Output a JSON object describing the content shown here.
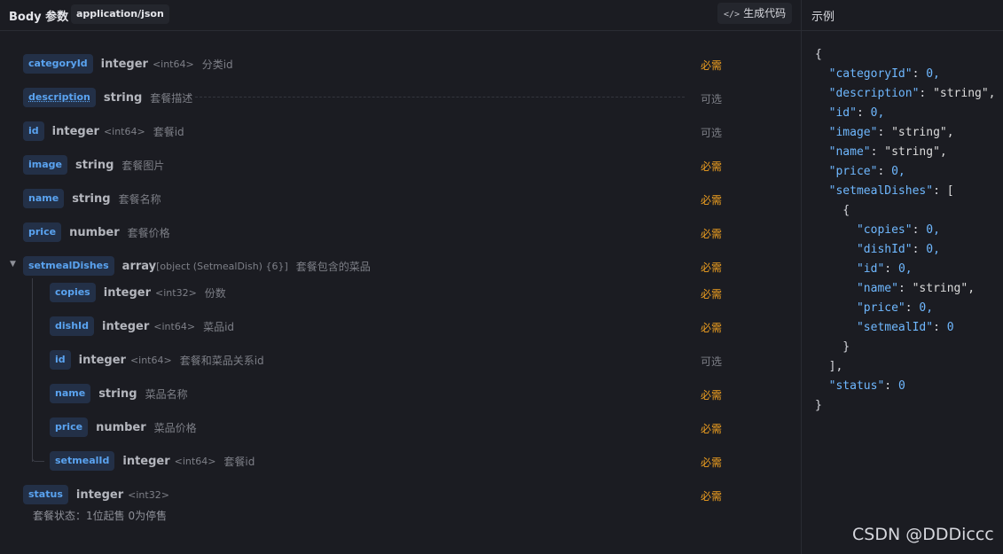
{
  "header": {
    "title": "Body 参数",
    "content_type": "application/json",
    "generate_button": "生成代码",
    "code_glyph": "</>"
  },
  "example": {
    "title": "示例"
  },
  "fields": [
    {
      "name": "categoryId",
      "type": "integer",
      "format": "<int64>",
      "description": "分类id",
      "required": "必需"
    },
    {
      "name": "description",
      "type": "string",
      "format": "",
      "description": "套餐描述",
      "required": "可选"
    },
    {
      "name": "id",
      "type": "integer",
      "format": "<int64>",
      "description": "套餐id",
      "required": "可选"
    },
    {
      "name": "image",
      "type": "string",
      "format": "",
      "description": "套餐图片",
      "required": "必需"
    },
    {
      "name": "name",
      "type": "string",
      "format": "",
      "description": "套餐名称",
      "required": "必需"
    },
    {
      "name": "price",
      "type": "number",
      "format": "",
      "description": "套餐价格",
      "required": "必需"
    },
    {
      "name": "setmealDishes",
      "type": "array",
      "format": "[object (SetmealDish) {6}]",
      "description": "套餐包含的菜品",
      "required": "必需",
      "caret": "▼"
    },
    {
      "name": "copies",
      "type": "integer",
      "format": "<int32>",
      "description": "份数",
      "required": "必需"
    },
    {
      "name": "dishId",
      "type": "integer",
      "format": "<int64>",
      "description": "菜品id",
      "required": "必需"
    },
    {
      "name": "id",
      "type": "integer",
      "format": "<int64>",
      "description": "套餐和菜品关系id",
      "required": "可选"
    },
    {
      "name": "name",
      "type": "string",
      "format": "",
      "description": "菜品名称",
      "required": "必需"
    },
    {
      "name": "price",
      "type": "number",
      "format": "",
      "description": "菜品价格",
      "required": "必需"
    },
    {
      "name": "setmealId",
      "type": "integer",
      "format": "<int64>",
      "description": "套餐id",
      "required": "必需"
    },
    {
      "name": "status",
      "type": "integer",
      "format": "<int32>",
      "description": "",
      "required": "必需"
    }
  ],
  "status_note": "套餐状态：1位起售 0为停售",
  "code_lines": [
    "{",
    "  \"categoryId\": 0,",
    "  \"description\": \"string\",",
    "  \"id\": 0,",
    "  \"image\": \"string\",",
    "  \"name\": \"string\",",
    "  \"price\": 0,",
    "  \"setmealDishes\": [",
    "    {",
    "      \"copies\": 0,",
    "      \"dishId\": 0,",
    "      \"id\": 0,",
    "      \"name\": \"string\",",
    "      \"price\": 0,",
    "      \"setmealId\": 0",
    "    }",
    "  ],",
    "  \"status\": 0",
    "}"
  ],
  "watermark": "CSDN @DDDiccc",
  "colors": {
    "background": "#1b1c22",
    "tag_bg": "#233047",
    "tag_text": "#5aa3f0",
    "required": "#f0a020",
    "optional": "#7d7f87"
  }
}
